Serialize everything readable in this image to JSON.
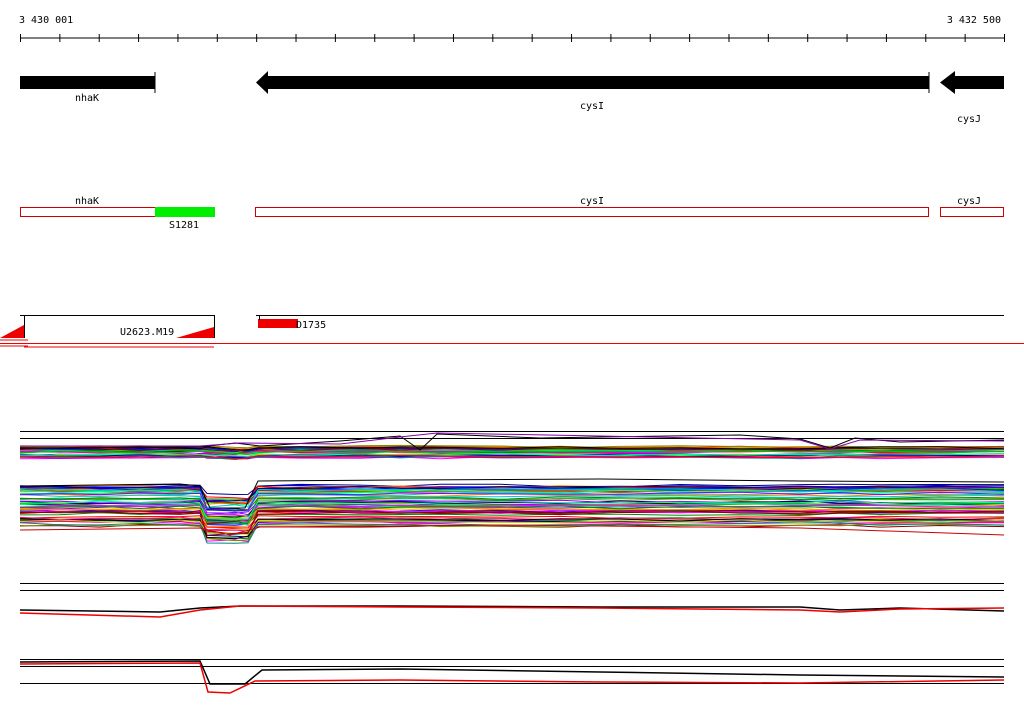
{
  "coords": {
    "start": "3 430 001",
    "end": "3 432 500"
  },
  "arrow_track": {
    "color": "#000000",
    "genes": [
      {
        "name": "nhaK",
        "direction": "none"
      },
      {
        "name": "cysI",
        "direction": "left"
      },
      {
        "name": "cysJ",
        "direction": "left"
      }
    ]
  },
  "box_track": {
    "outline_color": "#d00000",
    "genes": [
      {
        "name": "nhaK"
      },
      {
        "name": "cysI"
      },
      {
        "name": "cysJ"
      }
    ],
    "feature": {
      "name": "S1281",
      "color": "#00ee00"
    }
  },
  "probe_track": {
    "color": "#ee0000",
    "features": [
      {
        "name": "U2623.M19"
      },
      {
        "name": "D1735"
      }
    ]
  },
  "colors": {
    "expression_palette": [
      "#ff0000",
      "#00cc00",
      "#0000ff",
      "#ff00ff",
      "#00cccc",
      "#cccc00",
      "#ff8800",
      "#8800ff",
      "#008800",
      "#880000",
      "#000088",
      "#00ff88",
      "#ff0088",
      "#888800",
      "#008888",
      "#000000"
    ],
    "profile_red": "#ee0000",
    "profile_black": "#000000"
  }
}
